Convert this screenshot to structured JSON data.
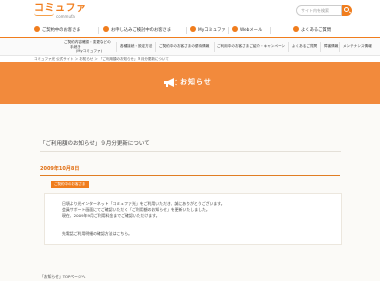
{
  "header": {
    "logo_text": "コミュファ",
    "logo_sub": "commufa",
    "search_placeholder": "サイト内を検索"
  },
  "nav_main": {
    "items": [
      {
        "label": "ご契約中のお客さま"
      },
      {
        "label": "お申し込みご検討中のお客さま"
      },
      {
        "label": "Myコミュファ"
      },
      {
        "label": "Webメール"
      },
      {
        "label": "よくあるご質問"
      }
    ]
  },
  "nav_sub": {
    "items": [
      {
        "line1": "ご契約内容確認・変更などの",
        "line2": "手続き",
        "line3": "(Myコミュファ)"
      },
      {
        "line1": "各種接続・設定方法",
        "line2": "",
        "line3": ""
      },
      {
        "line1": "ご契約中のお客さまの優待情報",
        "line2": "",
        "line3": ""
      },
      {
        "line1": "ご利用中のお客さまご紹介・キャンペーン",
        "line2": "",
        "line3": ""
      },
      {
        "line1": "よくあるご質問",
        "line2": "",
        "line3": ""
      },
      {
        "line1": "障害情報",
        "line2": "",
        "line3": ""
      },
      {
        "line1": "メンテナンス情報",
        "line2": "",
        "line3": ""
      }
    ]
  },
  "breadcrumb": "コミュファ光 公式サイト ＞ お知らせ ＞ 「ご利用額のお知らせ」９月分更新について",
  "banner": {
    "title": "お知らせ"
  },
  "article": {
    "heading": "「ご利用額のお知らせ」９月分更新について",
    "date": "2009年10月8日",
    "badge": "ご契約中のお客さま",
    "lines": [
      "日頃より光インターネット「コミュファ光」をご利用いただき、誠にありがとうございます。",
      "会員サポート画面にてご確認いただく「ご利用額のお知らせ」を更新いたしました。",
      "現在、2009年9月ご利用料金までご確認いただけます。",
      "",
      "先電話ご利用明細の確認方法はこちら。"
    ],
    "back_link": "「お知らせ」TOPページへ"
  },
  "colors": {
    "brand_orange": "#f07d1d",
    "banner_orange": "#f28a3c",
    "date_orange": "#e06d10"
  }
}
